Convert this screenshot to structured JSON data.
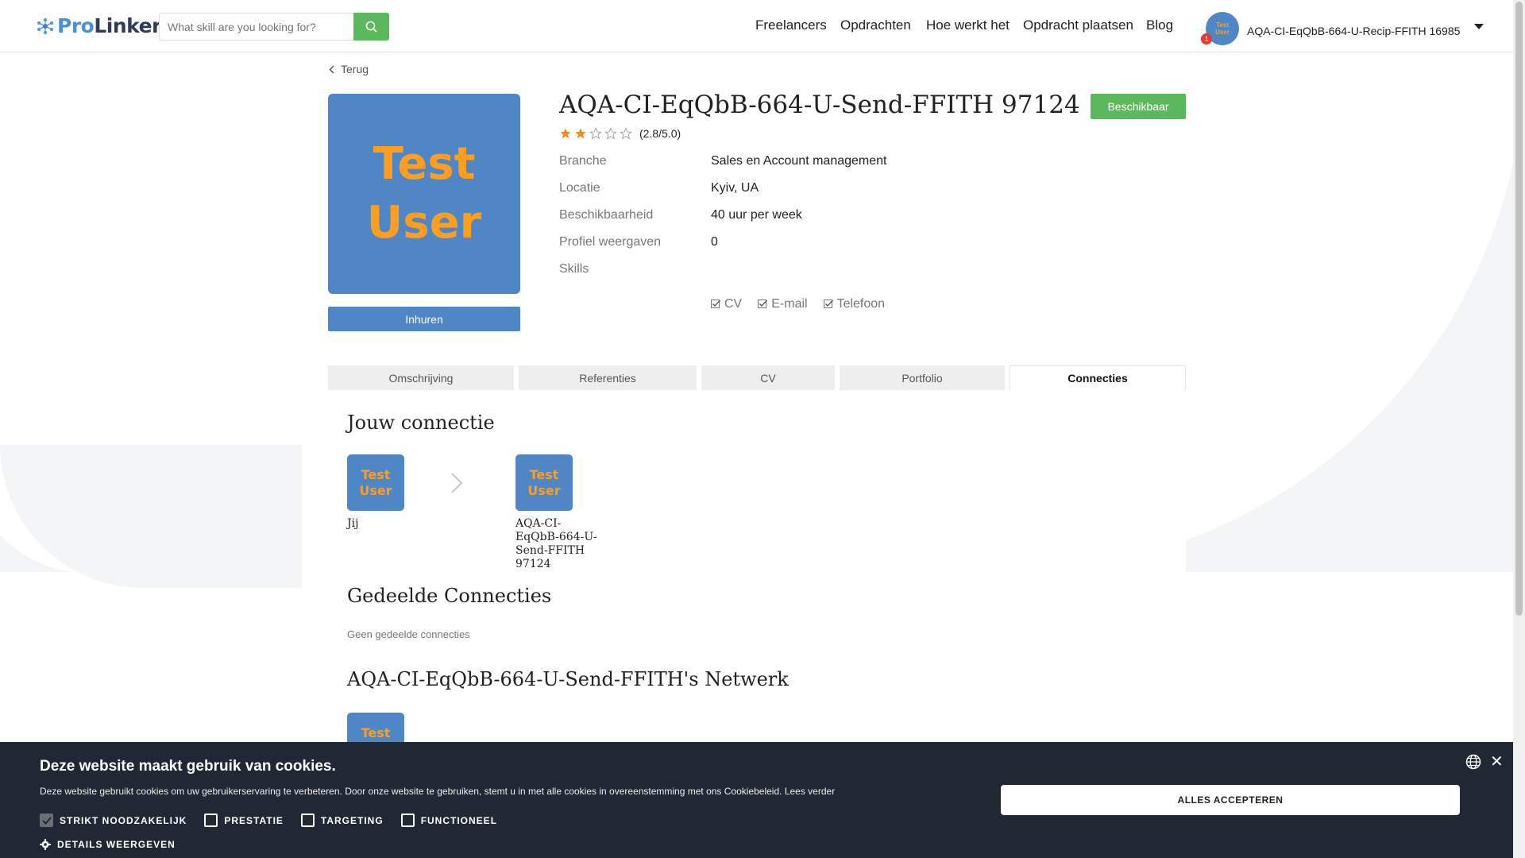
{
  "header": {
    "logo_pro": "Pro",
    "logo_linker": "Linker",
    "search_placeholder": "What skill are you looking for?",
    "nav": [
      "Freelancers",
      "Opdrachten",
      "Hoe werkt het",
      "Opdracht plaatsen",
      "Blog"
    ],
    "notification_count": "1",
    "user_name": "AQA-CI-EqQbB-664-U-Recip-FFITH 16985",
    "avatar_text_1": "Test",
    "avatar_text_2": "User"
  },
  "profile": {
    "back_label": "Terug",
    "image_text_1": "Test",
    "image_text_2": "User",
    "hire_label": "Inhuren",
    "name": "AQA-CI-EqQbB-664-U-Send-FFITH 97124",
    "status_label": "Beschikbaar",
    "rating_value": 2.8,
    "rating_max": 5,
    "rating_text": "(2.8/5.0)",
    "info": [
      {
        "key": "Branche",
        "value": "Sales en Account management"
      },
      {
        "key": "Locatie",
        "value": "Kyiv, UA"
      },
      {
        "key": "Beschikbaarheid",
        "value": "40 uur per week"
      },
      {
        "key": "Profiel weergaven",
        "value": "0"
      },
      {
        "key": "Skills",
        "value": ""
      }
    ],
    "checks": [
      "CV",
      "E-mail",
      "Telefoon"
    ]
  },
  "tabs": [
    "Omschrijving",
    "Referenties",
    "CV",
    "Portfolio",
    "Connecties"
  ],
  "active_tab": "Connecties",
  "connections": {
    "title": "Jouw connectie",
    "you_label": "Jij",
    "avatar_text_1": "Test",
    "avatar_text_2": "User",
    "target_label": "AQA-CI-EqQbB-664-U-Send-FFITH 97124",
    "shared_title": "Gedeelde Connecties",
    "shared_empty": "Geen gedeelde connecties",
    "network_title": "AQA-CI-EqQbB-664-U-Send-FFITH's Netwerk"
  },
  "cookie": {
    "title": "Deze website maakt gebruik van cookies.",
    "text": "Deze website gebruikt cookies om uw gebruikerservaring te verbeteren. Door onze website te gebruiken, stemt u in met alle cookies in overeenstemming met ons Cookiebeleid.",
    "link": "Lees verder",
    "options": [
      {
        "label": "STRIKT NOODZAKELIJK",
        "checked": true
      },
      {
        "label": "PRESTATIE",
        "checked": false
      },
      {
        "label": "TARGETING",
        "checked": false
      },
      {
        "label": "FUNCTIONEEL",
        "checked": false
      }
    ],
    "details_label": "DETAILS WEERGEVEN",
    "accept_label": "ALLES ACCEPTEREN",
    "close_symbol": "✕"
  },
  "colors": {
    "brand_blue": "#4f86c5",
    "accent_green": "#5cb85c",
    "star_orange": "#f08a24",
    "cookie_bg": "#202833"
  }
}
